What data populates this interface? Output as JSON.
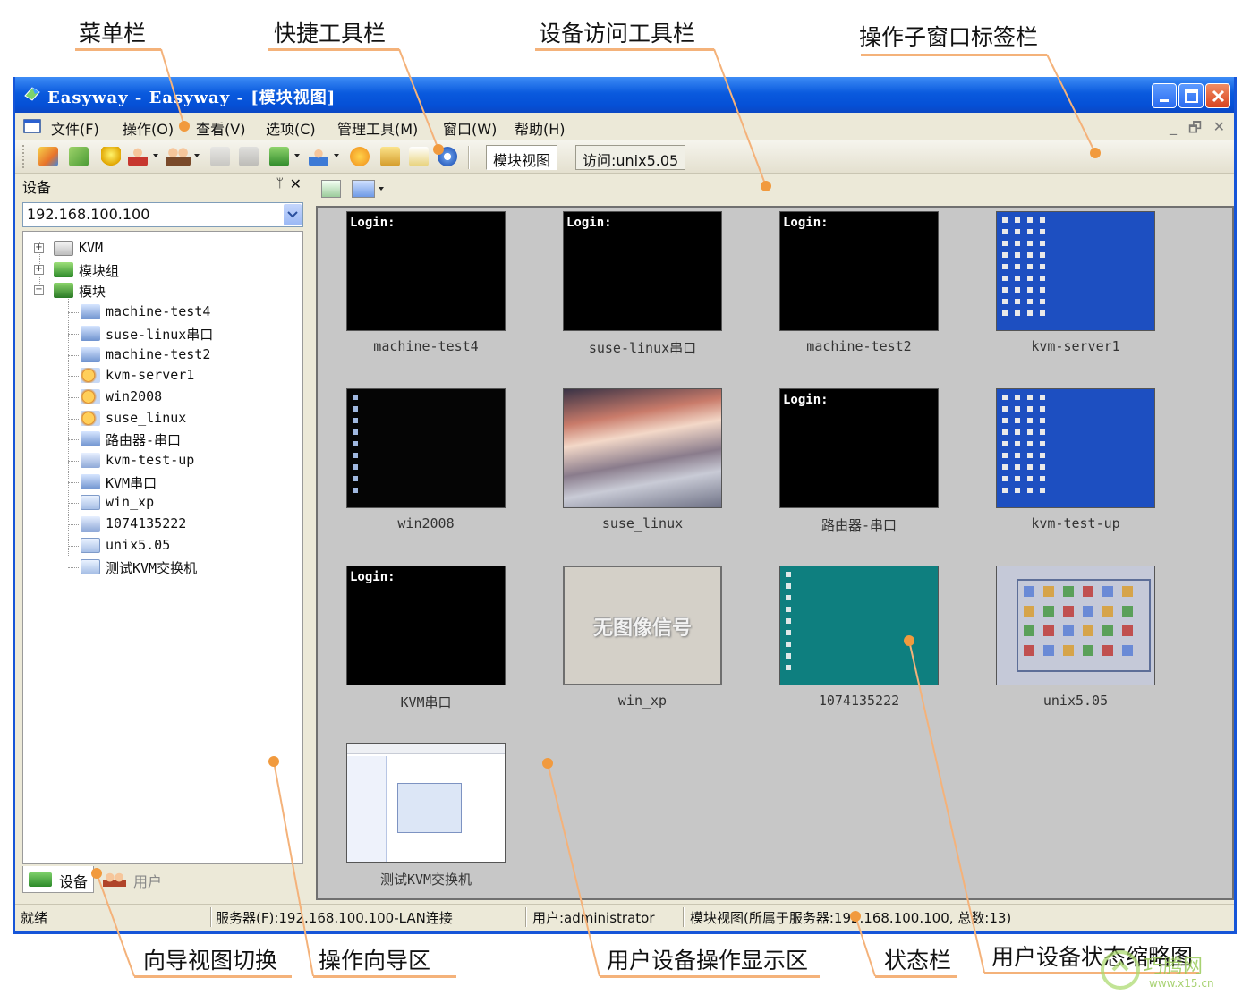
{
  "annotations": {
    "menubar": "菜单栏",
    "quick_toolbar": "快捷工具栏",
    "device_access_toolbar": "设备访问工具栏",
    "window_tabbar": "操作子窗口标签栏",
    "nav_view_switch": "向导视图切换",
    "nav_area": "操作向导区",
    "device_display_area": "用户设备操作显示区",
    "statusbar": "状态栏",
    "device_thumbnail": "用户设备状态缩略图"
  },
  "window": {
    "title": "Easyway - Easyway - [模块视图]"
  },
  "menu": {
    "items": [
      "文件(F)",
      "操作(O)",
      "查看(V)",
      "选项(C)",
      "管理工具(M)",
      "窗口(W)",
      "帮助(H)"
    ],
    "mdi_controls": [
      "_",
      "🗗",
      "✕"
    ]
  },
  "tabs": [
    {
      "label": "模块视图",
      "active": true
    },
    {
      "label": "访问:unix5.05",
      "active": false
    }
  ],
  "left_panel": {
    "title": "设备",
    "pin_glyph": "ᛘ",
    "close_glyph": "✕",
    "server_address": "192.168.100.100",
    "tree": [
      {
        "label": "KVM",
        "level": 0,
        "expander": "+",
        "icon": "kvm-folder-icon"
      },
      {
        "label": "模块组",
        "level": 0,
        "expander": "+",
        "icon": "module-group-icon"
      },
      {
        "label": "模块",
        "level": 0,
        "expander": "−",
        "icon": "module-icon"
      },
      {
        "label": "machine-test4",
        "level": 1,
        "icon": "serial-port-icon"
      },
      {
        "label": "suse-linux串口",
        "level": 1,
        "icon": "serial-port-icon"
      },
      {
        "label": "machine-test2",
        "level": 1,
        "icon": "serial-port-icon"
      },
      {
        "label": "kvm-server1",
        "level": 1,
        "icon": "kvm-active-icon"
      },
      {
        "label": "win2008",
        "level": 1,
        "icon": "kvm-active-icon"
      },
      {
        "label": "suse_linux",
        "level": 1,
        "icon": "kvm-active-icon"
      },
      {
        "label": "路由器-串口",
        "level": 1,
        "icon": "serial-port-icon"
      },
      {
        "label": "kvm-test-up",
        "level": 1,
        "icon": "kvm-link-icon"
      },
      {
        "label": "KVM串口",
        "level": 1,
        "icon": "serial-port-icon"
      },
      {
        "label": "win_xp",
        "level": 1,
        "icon": "kvm-device-icon"
      },
      {
        "label": "1074135222",
        "level": 1,
        "icon": "kvm-link-icon"
      },
      {
        "label": "unix5.05",
        "level": 1,
        "icon": "kvm-device-icon"
      },
      {
        "label": "测试KVM交换机",
        "level": 1,
        "icon": "kvm-device-icon"
      }
    ],
    "bottom_tabs": [
      {
        "label": "设备",
        "active": true
      },
      {
        "label": "用户",
        "active": false
      }
    ]
  },
  "thumbnails": [
    {
      "label": "machine-test4",
      "kind": "login",
      "screen_text": "Login:"
    },
    {
      "label": "suse-linux串口",
      "kind": "login",
      "screen_text": "Login:"
    },
    {
      "label": "machine-test2",
      "kind": "login",
      "screen_text": "Login:"
    },
    {
      "label": "kvm-server1",
      "kind": "blue-desktop"
    },
    {
      "label": "win2008",
      "kind": "black-desktop"
    },
    {
      "label": "suse_linux",
      "kind": "sky-wallpaper"
    },
    {
      "label": "路由器-串口",
      "kind": "login",
      "screen_text": "Login:"
    },
    {
      "label": "kvm-test-up",
      "kind": "blue-desktop"
    },
    {
      "label": "KVM串口",
      "kind": "login",
      "screen_text": "Login:"
    },
    {
      "label": "win_xp",
      "kind": "no-signal",
      "screen_text": "无图像信号"
    },
    {
      "label": "1074135222",
      "kind": "teal-desktop"
    },
    {
      "label": "unix5.05",
      "kind": "unix-desktop"
    },
    {
      "label": "测试KVM交换机",
      "kind": "dialog-screen"
    }
  ],
  "statusbar": {
    "ready": "就绪",
    "server": "服务器(F):192.168.100.100-LAN连接",
    "user": "用户:administrator",
    "view": "模块视图(所属于服务器:192.168.100.100, 总数:13)"
  },
  "watermark": {
    "site_name": "巧腾网",
    "url": "www.x15.cn"
  },
  "colors": {
    "titlebar": "#0a5ade",
    "accent_orange": "#f19a3e",
    "view_background": "#c7c7c7",
    "teal_desktop": "#0e7f7f",
    "xp_blue": "#1d4fc1"
  }
}
